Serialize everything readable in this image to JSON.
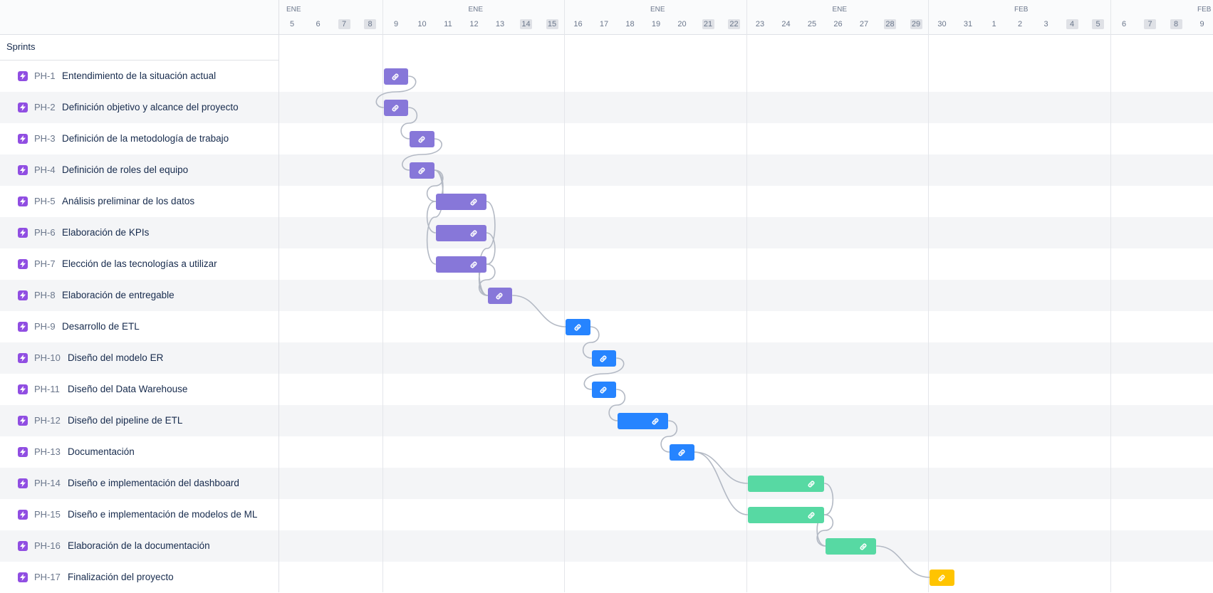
{
  "header": {
    "months": [
      "ENE",
      "ENE",
      "ENE",
      "ENE",
      "FEB",
      "FEB"
    ],
    "days": [
      "5",
      "6",
      "7",
      "8",
      "9",
      "10",
      "11",
      "12",
      "13",
      "14",
      "15",
      "16",
      "17",
      "18",
      "19",
      "20",
      "21",
      "22",
      "23",
      "24",
      "25",
      "26",
      "27",
      "28",
      "29",
      "30",
      "31",
      "1",
      "2",
      "3",
      "4",
      "5",
      "6",
      "7",
      "8",
      "9"
    ],
    "weekend_days": [
      "7",
      "8",
      "14",
      "15",
      "21",
      "22",
      "28",
      "29",
      "4",
      "5"
    ]
  },
  "group": {
    "label": "Sprints"
  },
  "colors": {
    "purple": "#8777d9",
    "blue": "#2684ff",
    "green": "#57d9a3",
    "yellow": "#ffc400",
    "epic": "#904ee2"
  },
  "icons": {
    "row_icon": "epic-lightning-icon",
    "bar_icon": "link-icon"
  },
  "tasks": [
    {
      "key": "PH-1",
      "title": "Entendimiento de la situación actual",
      "start": "9",
      "end": "9",
      "color": "purple"
    },
    {
      "key": "PH-2",
      "title": "Definición objetivo y alcance del proyecto",
      "start": "9",
      "end": "9",
      "color": "purple"
    },
    {
      "key": "PH-3",
      "title": "Definición de la metodología de trabajo",
      "start": "10",
      "end": "10",
      "color": "purple"
    },
    {
      "key": "PH-4",
      "title": "Definición de roles del equipo",
      "start": "10",
      "end": "10",
      "color": "purple"
    },
    {
      "key": "PH-5",
      "title": "Análisis preliminar de los datos",
      "start": "11",
      "end": "12",
      "color": "purple"
    },
    {
      "key": "PH-6",
      "title": "Elaboración de KPIs",
      "start": "11",
      "end": "12",
      "color": "purple"
    },
    {
      "key": "PH-7",
      "title": "Elección de las tecnologías a utilizar",
      "start": "11",
      "end": "12",
      "color": "purple"
    },
    {
      "key": "PH-8",
      "title": "Elaboración de entregable",
      "start": "13",
      "end": "13",
      "color": "purple"
    },
    {
      "key": "PH-9",
      "title": "Desarrollo de ETL",
      "start": "16",
      "end": "16",
      "color": "blue"
    },
    {
      "key": "PH-10",
      "title": "Diseño del modelo ER",
      "start": "17",
      "end": "17",
      "color": "blue"
    },
    {
      "key": "PH-11",
      "title": "Diseño del Data Warehouse",
      "start": "17",
      "end": "17",
      "color": "blue"
    },
    {
      "key": "PH-12",
      "title": "Diseño del pipeline de ETL",
      "start": "18",
      "end": "19",
      "color": "blue"
    },
    {
      "key": "PH-13",
      "title": "Documentación",
      "start": "20",
      "end": "20",
      "color": "blue"
    },
    {
      "key": "PH-14",
      "title": "Diseño e implementación del dashboard",
      "start": "23",
      "end": "25",
      "color": "green"
    },
    {
      "key": "PH-15",
      "title": "Diseño e implementación de modelos de ML",
      "start": "23",
      "end": "25",
      "color": "green"
    },
    {
      "key": "PH-16",
      "title": "Elaboración de la documentación",
      "start": "26",
      "end": "27",
      "color": "green"
    },
    {
      "key": "PH-17",
      "title": "Finalización del proyecto",
      "start": "30",
      "end": "30",
      "color": "yellow"
    }
  ],
  "dependencies": [
    [
      "PH-1",
      "PH-2"
    ],
    [
      "PH-2",
      "PH-3"
    ],
    [
      "PH-3",
      "PH-4"
    ],
    [
      "PH-4",
      "PH-5"
    ],
    [
      "PH-4",
      "PH-6"
    ],
    [
      "PH-4",
      "PH-7"
    ],
    [
      "PH-5",
      "PH-8"
    ],
    [
      "PH-6",
      "PH-8"
    ],
    [
      "PH-7",
      "PH-8"
    ],
    [
      "PH-8",
      "PH-9"
    ],
    [
      "PH-9",
      "PH-10"
    ],
    [
      "PH-10",
      "PH-11"
    ],
    [
      "PH-11",
      "PH-12"
    ],
    [
      "PH-12",
      "PH-13"
    ],
    [
      "PH-13",
      "PH-14"
    ],
    [
      "PH-13",
      "PH-15"
    ],
    [
      "PH-14",
      "PH-16"
    ],
    [
      "PH-15",
      "PH-16"
    ],
    [
      "PH-16",
      "PH-17"
    ]
  ]
}
